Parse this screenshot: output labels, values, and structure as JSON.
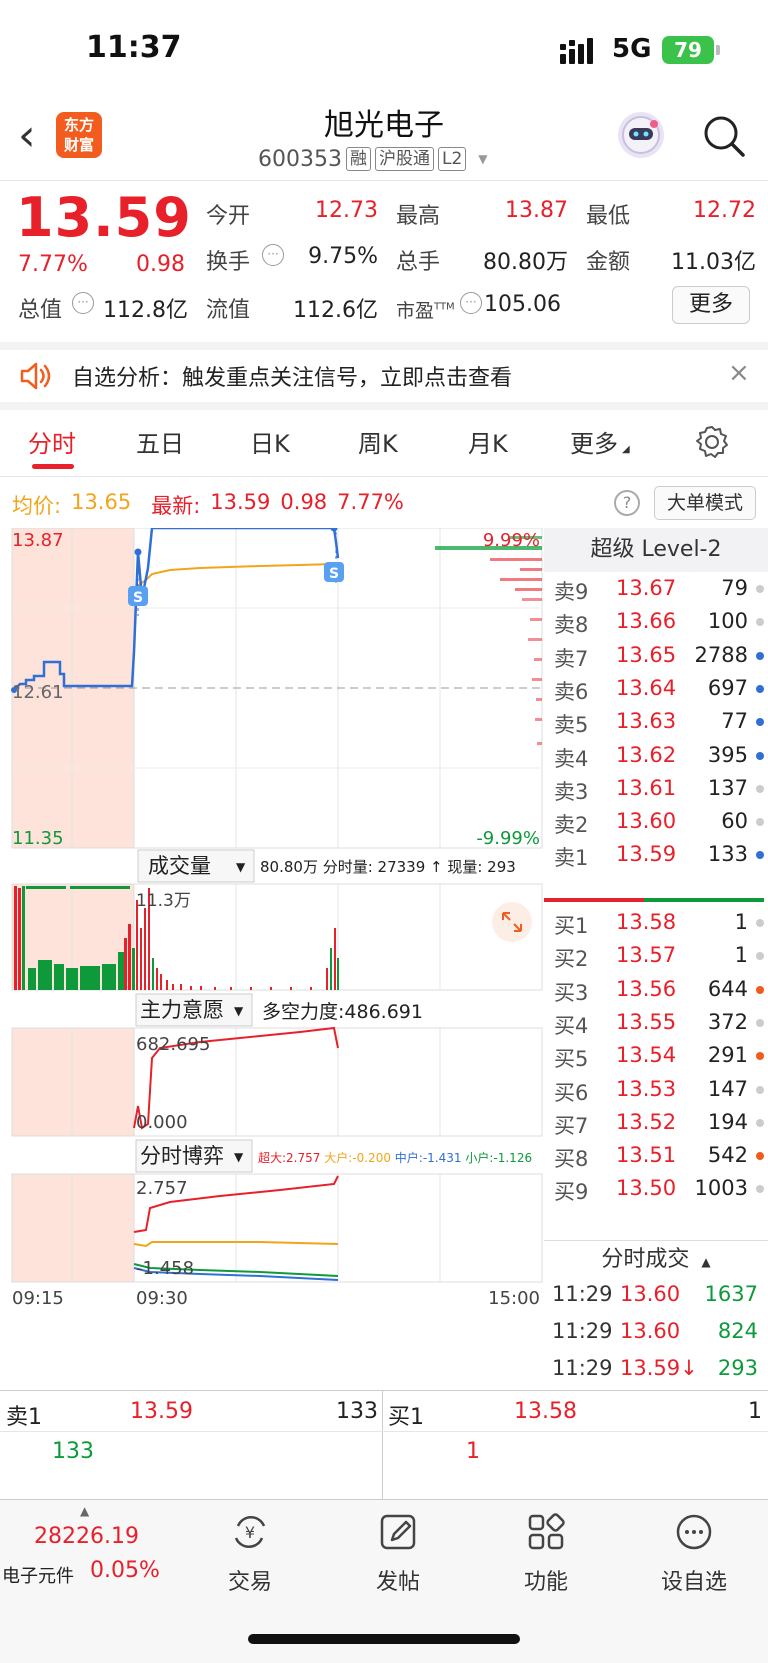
{
  "status": {
    "time": "11:37",
    "network": "5G",
    "battery": "79"
  },
  "header": {
    "logo_line1": "东方",
    "logo_line2": "财富",
    "name": "旭光电子",
    "code": "600353",
    "tags": [
      "融",
      "沪股通",
      "L2"
    ]
  },
  "quote": {
    "price": "13.59",
    "pct": "7.77%",
    "change": "0.98",
    "fields": [
      {
        "label": "今开",
        "value": "12.73",
        "color": "red"
      },
      {
        "label": "最高",
        "value": "13.87",
        "color": "red"
      },
      {
        "label": "最低",
        "value": "12.72",
        "color": "red"
      },
      {
        "label": "换手",
        "value": "9.75%",
        "color": "dark"
      },
      {
        "label": "总手",
        "value": "80.80万",
        "color": "dark"
      },
      {
        "label": "金额",
        "value": "11.03亿",
        "color": "dark"
      },
      {
        "label": "总值",
        "value": "112.8亿",
        "color": "dark"
      },
      {
        "label": "流值",
        "value": "112.6亿",
        "color": "dark"
      },
      {
        "label": "市盈",
        "sup": "TTM",
        "value": "105.06",
        "color": "dark"
      }
    ],
    "more_label": "更多"
  },
  "banner": {
    "text": "自选分析：触发重点关注信号，立即点击查看",
    "close": "×"
  },
  "tabs": [
    "分时",
    "五日",
    "日K",
    "周K",
    "月K",
    "更多"
  ],
  "info_line": {
    "avg_label": "均价:",
    "avg_value": "13.65",
    "latest_label": "最新:",
    "latest_value": "13.59",
    "change": "0.98",
    "pct": "7.77%",
    "help": "?",
    "big_order_btn": "大单模式"
  },
  "chart_labels": {
    "top_price": "13.87",
    "prev_close": "12.61",
    "bottom_price": "11.35",
    "top_pct": "9.99%",
    "bottom_pct": "-9.99%",
    "vol_selector": "成交量",
    "vol_info": "80.80万 分时量: 27339 ↑ 现量: 293",
    "vol_axis": "11.3万",
    "main_selector": "主力意愿",
    "main_info": "多空力度:486.691",
    "main_top": "682.695",
    "main_bottom": "0.000",
    "game_selector": "分时博弈",
    "game_super": "超大:2.757",
    "game_big": "大户:-0.200",
    "game_mid": "中户:-1.431",
    "game_small": "小户:-1.126",
    "game_top": "2.757",
    "game_bottom": "-1.458",
    "time_start": "09:15",
    "time_open": "09:30",
    "time_end": "15:00",
    "marker_s": "S"
  },
  "orderbook": {
    "title": "超级 Level-2",
    "asks": [
      {
        "label": "卖9",
        "price": "13.67",
        "vol": "79",
        "dot": "#cccccc"
      },
      {
        "label": "卖8",
        "price": "13.66",
        "vol": "100",
        "dot": "#cccccc"
      },
      {
        "label": "卖7",
        "price": "13.65",
        "vol": "2788",
        "dot": "#2f6fd6"
      },
      {
        "label": "卖6",
        "price": "13.64",
        "vol": "697",
        "dot": "#2f6fd6"
      },
      {
        "label": "卖5",
        "price": "13.63",
        "vol": "77",
        "dot": "#2f6fd6"
      },
      {
        "label": "卖4",
        "price": "13.62",
        "vol": "395",
        "dot": "#2f6fd6"
      },
      {
        "label": "卖3",
        "price": "13.61",
        "vol": "137",
        "dot": "#cccccc"
      },
      {
        "label": "卖2",
        "price": "13.60",
        "vol": "60",
        "dot": "#cccccc"
      },
      {
        "label": "卖1",
        "price": "13.59",
        "vol": "133",
        "dot": "#2f6fd6"
      }
    ],
    "bids": [
      {
        "label": "买1",
        "price": "13.58",
        "vol": "1",
        "dot": "#cccccc"
      },
      {
        "label": "买2",
        "price": "13.57",
        "vol": "1",
        "dot": "#cccccc"
      },
      {
        "label": "买3",
        "price": "13.56",
        "vol": "644",
        "dot": "#f05a1a"
      },
      {
        "label": "买4",
        "price": "13.55",
        "vol": "372",
        "dot": "#cccccc"
      },
      {
        "label": "买5",
        "price": "13.54",
        "vol": "291",
        "dot": "#f05a1a"
      },
      {
        "label": "买6",
        "price": "13.53",
        "vol": "147",
        "dot": "#cccccc"
      },
      {
        "label": "买7",
        "price": "13.52",
        "vol": "194",
        "dot": "#cccccc"
      },
      {
        "label": "买8",
        "price": "13.51",
        "vol": "542",
        "dot": "#f05a1a"
      },
      {
        "label": "买9",
        "price": "13.50",
        "vol": "1003",
        "dot": "#cccccc"
      }
    ],
    "trades_title": "分时成交",
    "trades": [
      {
        "time": "11:29",
        "price": "13.60",
        "vol": "1637"
      },
      {
        "time": "11:29",
        "price": "13.60",
        "vol": "824"
      },
      {
        "time": "11:29",
        "price": "13.59↓",
        "vol": "293"
      }
    ]
  },
  "bottom_orders": {
    "sell_label": "卖1",
    "sell_price": "13.59",
    "sell_vol": "133",
    "sell_sub": "133",
    "buy_label": "买1",
    "buy_price": "13.58",
    "buy_vol": "1",
    "buy_sub": "1"
  },
  "bottom_nav": {
    "index_value": "28226.19",
    "index_name": "电子元件",
    "index_pct": "0.05%",
    "items": [
      "交易",
      "发帖",
      "功能",
      "设自选"
    ]
  },
  "colors": {
    "up": "#e8202a",
    "down": "#0e9a3a",
    "price_line": "#2f6fd6",
    "avg_line": "#f2a51a"
  }
}
